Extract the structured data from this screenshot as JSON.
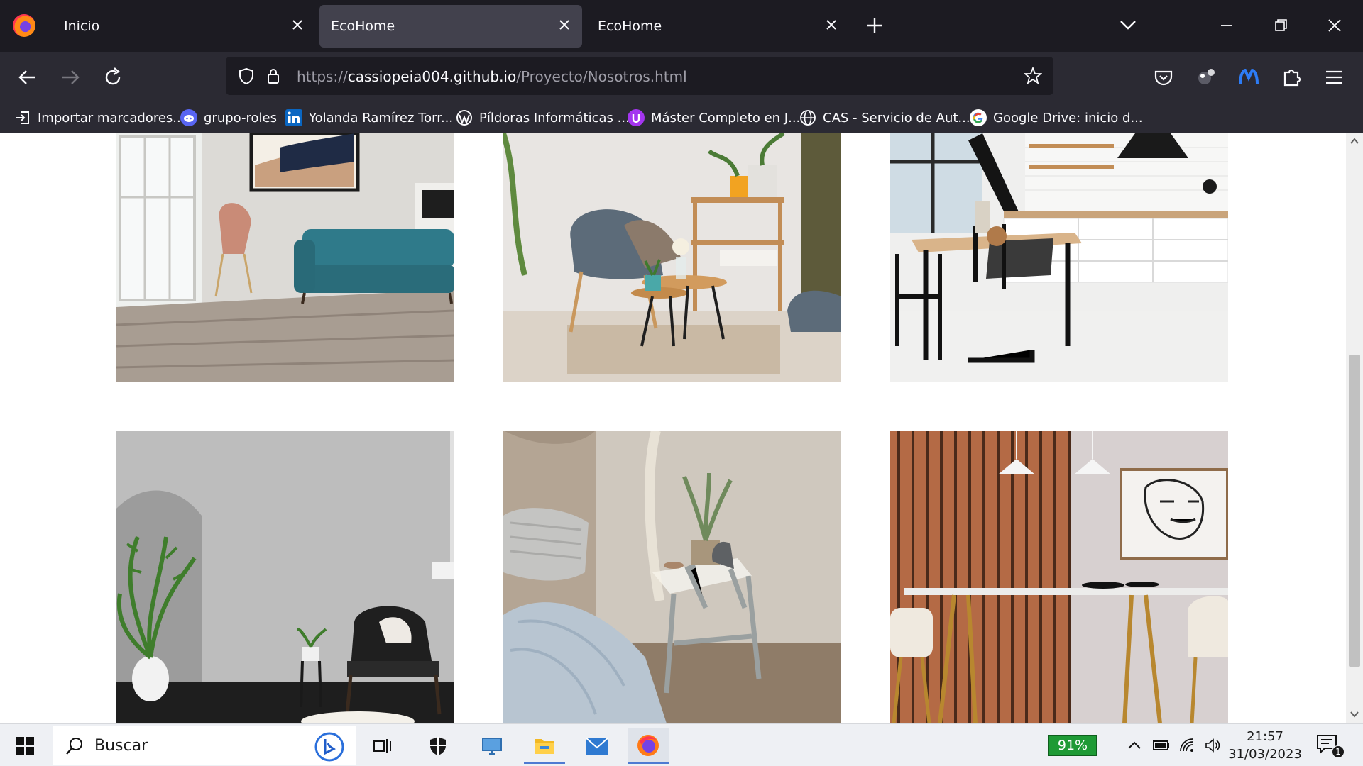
{
  "browser": {
    "tabs": [
      {
        "label": "Inicio",
        "active": false
      },
      {
        "label": "EcoHome",
        "active": true
      },
      {
        "label": "EcoHome",
        "active": false
      }
    ],
    "url": {
      "scheme": "https://",
      "host": "cassiopeia004.github.io",
      "path": "/Proyecto/Nosotros.html"
    },
    "bookmarks": [
      {
        "label": "Importar marcadores...",
        "icon": "import-icon"
      },
      {
        "label": "grupo-roles",
        "icon": "discord-icon"
      },
      {
        "label": "Yolanda Ramírez Torr...",
        "icon": "linkedin-icon"
      },
      {
        "label": "Píldoras Informáticas ...",
        "icon": "wordpress-icon"
      },
      {
        "label": "Máster Completo en J...",
        "icon": "udemy-icon"
      },
      {
        "label": "CAS - Servicio de Aut...",
        "icon": "globe-icon"
      },
      {
        "label": "Google Drive: inicio d...",
        "icon": "google-icon"
      }
    ]
  },
  "gallery": {
    "images": [
      {
        "name": "living-room-teal-sofa"
      },
      {
        "name": "armchair-coffee-table"
      },
      {
        "name": "kitchen-dining-table"
      },
      {
        "name": "grey-wall-palm-armchair"
      },
      {
        "name": "bedroom-side-table-plant"
      },
      {
        "name": "dining-wood-slat-wall"
      }
    ]
  },
  "taskbar": {
    "search_placeholder": "Buscar",
    "battery": "91%",
    "time": "21:57",
    "date": "31/03/2023",
    "notification_count": "1"
  },
  "colors": {
    "tabbar": "#1c1b22",
    "toolbar": "#2b2a33",
    "active_tab": "#42414d",
    "taskbar": "#eef0f4",
    "battery": "#1e9a35"
  }
}
